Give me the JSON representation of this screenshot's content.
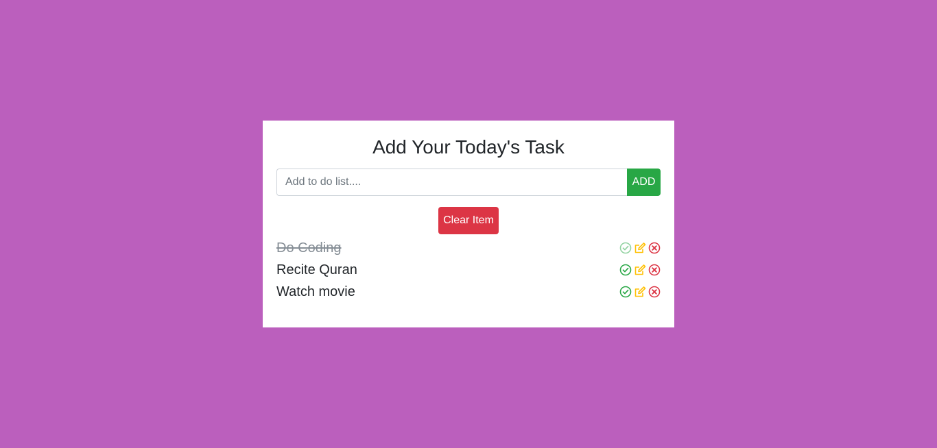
{
  "app": {
    "title": "Add Your Today's Task"
  },
  "input": {
    "placeholder": "Add to do list....",
    "value": ""
  },
  "buttons": {
    "add_label": "ADD",
    "clear_label": "Clear Item"
  },
  "todos": [
    {
      "text": "Do Coding",
      "completed": true
    },
    {
      "text": "Recite Quran",
      "completed": false
    },
    {
      "text": "Watch movie",
      "completed": false
    }
  ],
  "icons": {
    "check": "check-circle-icon",
    "edit": "edit-icon",
    "delete": "delete-circle-icon"
  },
  "colors": {
    "background": "#bb5fbd",
    "card": "#ffffff",
    "add_button": "#28a745",
    "clear_button": "#dc3545",
    "check_icon": "#28a745",
    "edit_icon": "#ffc107",
    "delete_icon": "#dc3545"
  }
}
